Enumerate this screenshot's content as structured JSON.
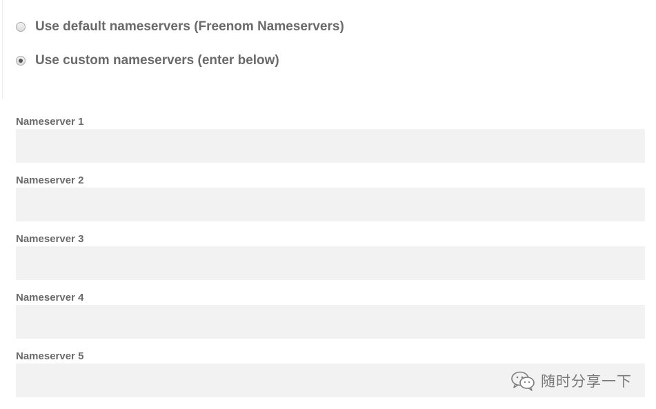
{
  "nameserver_options": {
    "default_label": "Use default nameservers (Freenom Nameservers)",
    "custom_label": "Use custom nameservers (enter below)",
    "selected": "custom"
  },
  "nameservers": [
    {
      "label": "Nameserver 1",
      "value": ""
    },
    {
      "label": "Nameserver 2",
      "value": ""
    },
    {
      "label": "Nameserver 3",
      "value": ""
    },
    {
      "label": "Nameserver 4",
      "value": ""
    },
    {
      "label": "Nameserver 5",
      "value": ""
    }
  ],
  "watermark": {
    "icon": "wechat-icon",
    "text": "随时分享一下"
  }
}
